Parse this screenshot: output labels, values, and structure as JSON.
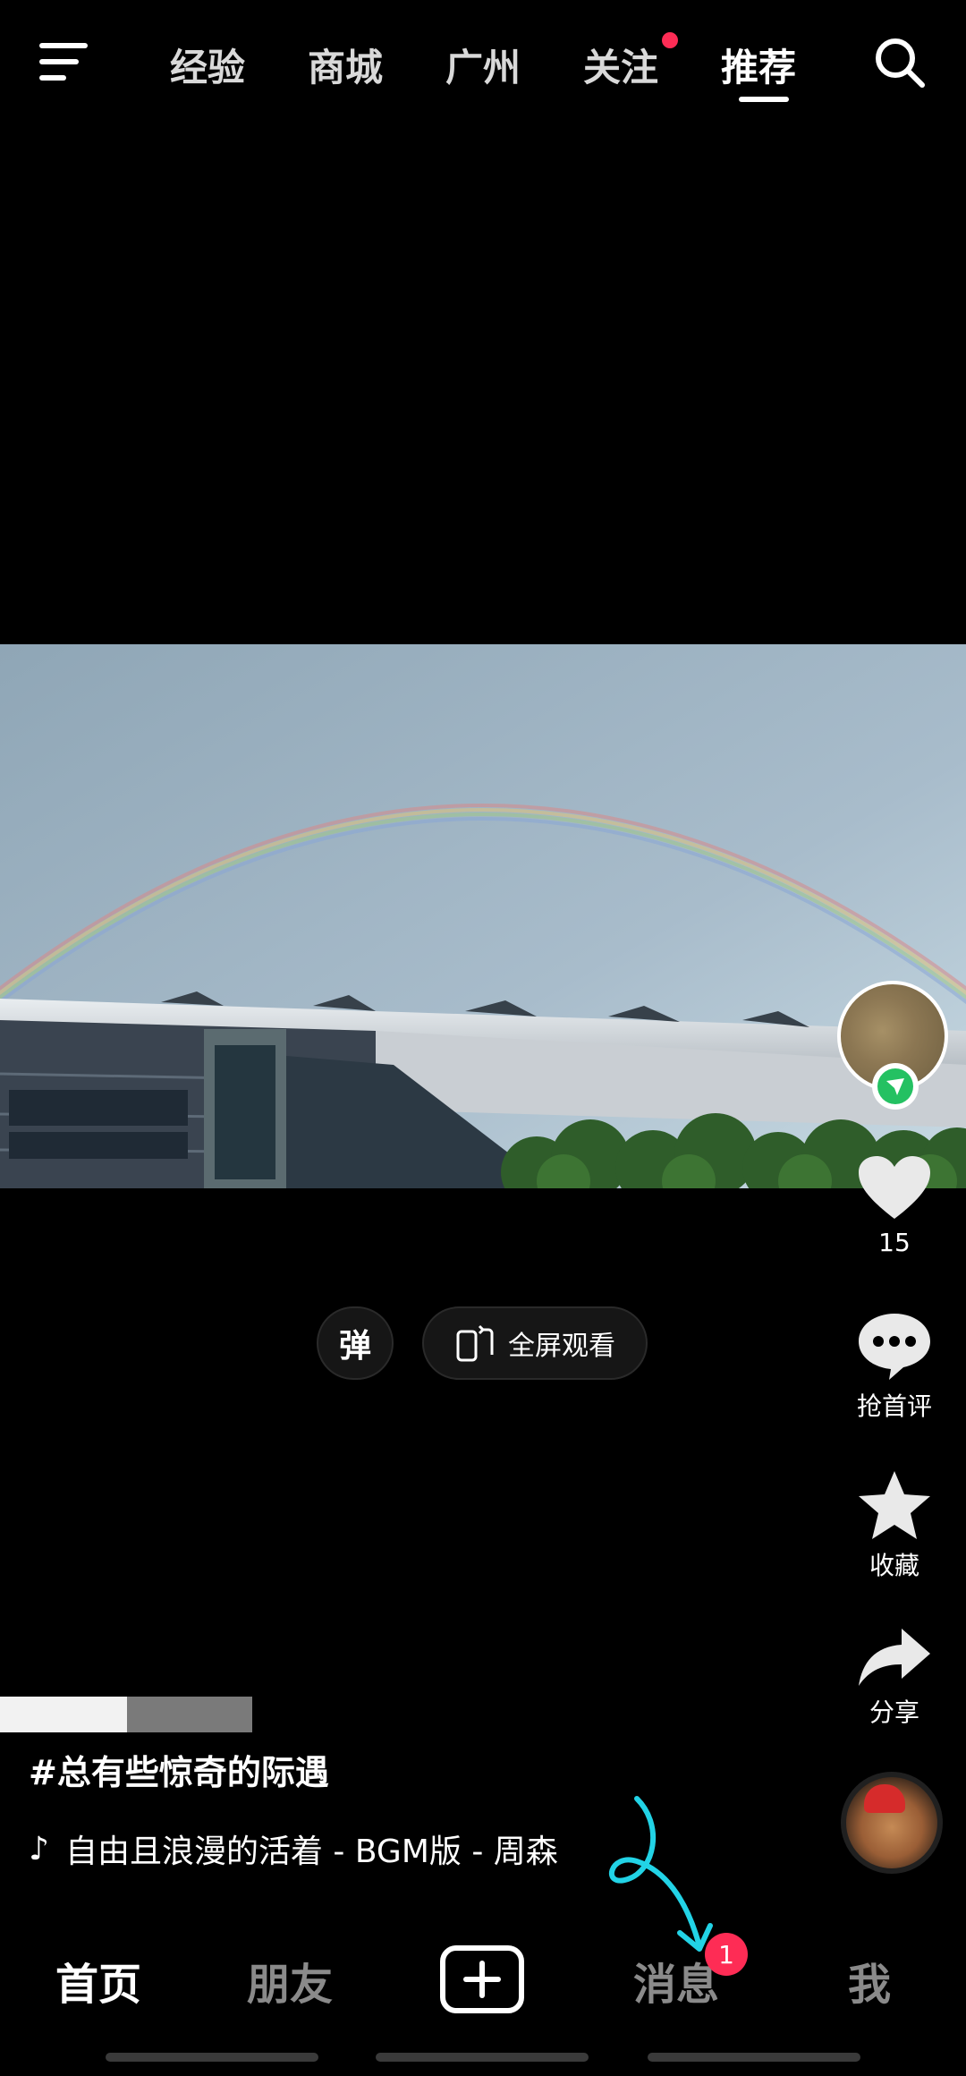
{
  "top_nav": {
    "tabs": [
      "经验",
      "商城",
      "广州",
      "关注",
      "推荐"
    ],
    "active_tab": "推荐"
  },
  "player": {
    "danmu_label": "弹",
    "fullscreen_label": "全屏观看"
  },
  "actions": {
    "like_count": "15",
    "comment_label": "抢首评",
    "favorite_label": "收藏",
    "share_label": "分享"
  },
  "post": {
    "caption": "#总有些惊奇的际遇",
    "music": "自由且浪漫的活着 - BGM版 - 周森"
  },
  "bottom_nav": {
    "home": "首页",
    "friends": "朋友",
    "messages": "消息",
    "messages_badge": "1",
    "me": "我"
  },
  "colors": {
    "accent_red": "#fe2c55",
    "follow_green": "#24c162",
    "annotation_cyan": "#22d3e6"
  }
}
